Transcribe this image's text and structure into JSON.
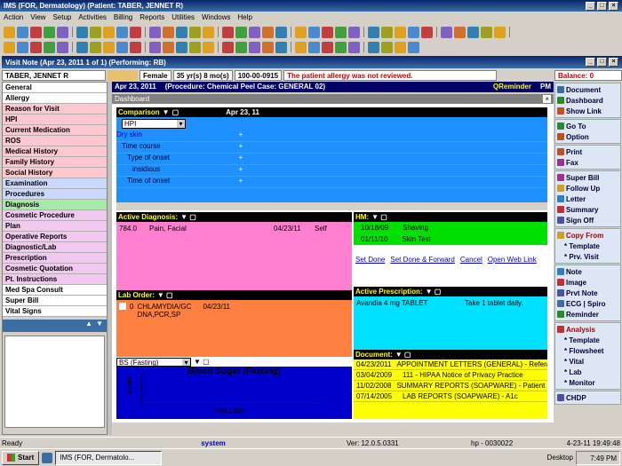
{
  "app": {
    "title": "IMS (FOR, Dermatology)    (Patient: TABER, JENNET R)"
  },
  "menu": [
    "Action",
    "View",
    "Setup",
    "Activities",
    "Billing",
    "Reports",
    "Utilities",
    "Windows",
    "Help"
  ],
  "visit": {
    "title": "Visit Note (Apr 23, 2011   1 of 1) (Performing: RB)"
  },
  "patient": {
    "name": "TABER, JENNET R",
    "sex": "Female",
    "age": "35 yr(s) 8 mo(s)",
    "id": "100-00-0915",
    "alert": "The patient allergy was not reviewed.",
    "balance": "Balance: 0"
  },
  "header": {
    "date": "Apr 23, 2011",
    "procedure": "(Procedure:  Chemical Peel  Case: GENERAL 02)",
    "reminder": "QReminder",
    "time": "PM"
  },
  "left_nav": [
    {
      "label": "General",
      "color": "#ffffff"
    },
    {
      "label": "Allergy",
      "color": "#ffffff"
    },
    {
      "label": "Reason for Visit",
      "color": "#ffc8d0"
    },
    {
      "label": "HPI",
      "color": "#ffc8d0"
    },
    {
      "label": "Current Medication",
      "color": "#ffc8d0"
    },
    {
      "label": "ROS",
      "color": "#ffc8d0"
    },
    {
      "label": "Medical History",
      "color": "#ffc8d0"
    },
    {
      "label": "Family History",
      "color": "#ffc8d0"
    },
    {
      "label": "Social History",
      "color": "#ffc8d0"
    },
    {
      "label": "Examination",
      "color": "#c8d8ff"
    },
    {
      "label": "Procedures",
      "color": "#c8d8ff"
    },
    {
      "label": "Diagnosis",
      "color": "#a8e8a8"
    },
    {
      "label": "Cosmetic Procedure",
      "color": "#f0c8f0"
    },
    {
      "label": "Plan",
      "color": "#f0c8f0"
    },
    {
      "label": "Operative Reports",
      "color": "#f0c8f0"
    },
    {
      "label": "Diagnostic/Lab",
      "color": "#f0c8f0"
    },
    {
      "label": "Prescription",
      "color": "#f0c8f0"
    },
    {
      "label": "Cosmetic Quotation",
      "color": "#f0c8f0"
    },
    {
      "label": "Pt. Instructions",
      "color": "#f0c8f0"
    },
    {
      "label": "Med Spa Consult",
      "color": "#ffffff"
    },
    {
      "label": "Super Bill",
      "color": "#ffffff"
    },
    {
      "label": "Vital Signs",
      "color": "#ffffff"
    }
  ],
  "right_groups": [
    {
      "items": [
        "Document",
        "Dashboard",
        "Show Link"
      ]
    },
    {
      "items": [
        "Go To",
        "Option"
      ]
    },
    {
      "items": [
        "Print",
        "Fax"
      ]
    },
    {
      "items": [
        "Super Bill",
        "Follow Up",
        "Letter",
        "Summary",
        "Sign Off"
      ]
    },
    {
      "items": [
        "Copy From",
        "* Template",
        "* Prv. Visit"
      ]
    },
    {
      "items": [
        "Note",
        "Image",
        "Prvt Note",
        "ECG | Spiro",
        "Reminder"
      ]
    },
    {
      "items": [
        "Analysis",
        "* Template",
        "* Flowsheet",
        "* Vital",
        "* Lab",
        "* Monitor"
      ]
    },
    {
      "items": [
        "CHDP"
      ]
    }
  ],
  "dashboard": {
    "title": "Dashboard"
  },
  "comparison": {
    "title": "Comparison",
    "date": "Apr 23, 11",
    "select": "HPI",
    "rows": [
      {
        "label": "Dry skin",
        "val": "+"
      },
      {
        "label": "Time course",
        "val": "+"
      },
      {
        "label": "Type of onset",
        "val": "+"
      },
      {
        "label": "insidious",
        "val": "+"
      },
      {
        "label": "Time of onset",
        "val": "+"
      }
    ]
  },
  "diagnosis": {
    "title": "Active Diagnosis:",
    "rows": [
      {
        "code": "784.0",
        "desc": "Pain, Facial",
        "date": "04/23/11",
        "by": "Self"
      }
    ]
  },
  "hm": {
    "title": "HM:",
    "rows": [
      {
        "date": "10/18/09",
        "item": "Shaving"
      },
      {
        "date": "01/11/10",
        "item": "Skin Test"
      }
    ],
    "links": [
      "Set Done",
      "Set Done & Forward",
      "Cancel",
      "Open Web Link"
    ]
  },
  "lab": {
    "title": "Lab Order:",
    "row": {
      "count": "0",
      "name": "CHLAMYDIA/GC DNA,PCR,SP",
      "date": "04/23/11"
    }
  },
  "prescription": {
    "title": "Active Prescription:",
    "rows": [
      {
        "drug": "Avandia 4 mg TABLET",
        "sig": "Take 1 tablet daily."
      }
    ]
  },
  "graph": {
    "select": "BS (Fasting)",
    "title": "Blood Sugar (Fasting)",
    "xlabel": "Visit Date",
    "ylabel": "Result"
  },
  "document": {
    "title": "Document:",
    "rows": [
      {
        "date": "04/23/2011",
        "name": "APPOINTMENT LETTERS (GENERAL) - Referal"
      },
      {
        "date": "03/04/2009",
        "name": "111 - HIPAA Notice of Privacy Practice"
      },
      {
        "date": "11/02/2008",
        "name": "SUMMARY REPORTS (SOAPWARE) - Patient S"
      },
      {
        "date": "07/14/2005",
        "name": "LAB REPORTS (SOAPWARE) - A1c"
      }
    ]
  },
  "status": {
    "ready": "Ready",
    "user": "system",
    "version": "Ver: 12.0.5.0331",
    "host": "hp - 0030022",
    "datetime": "4-23-11  19:49:48"
  },
  "taskbar": {
    "start": "Start",
    "task": "IMS (FOR, Dermatolo...",
    "desktop": "Desktop",
    "clock": "7:49 PM"
  }
}
